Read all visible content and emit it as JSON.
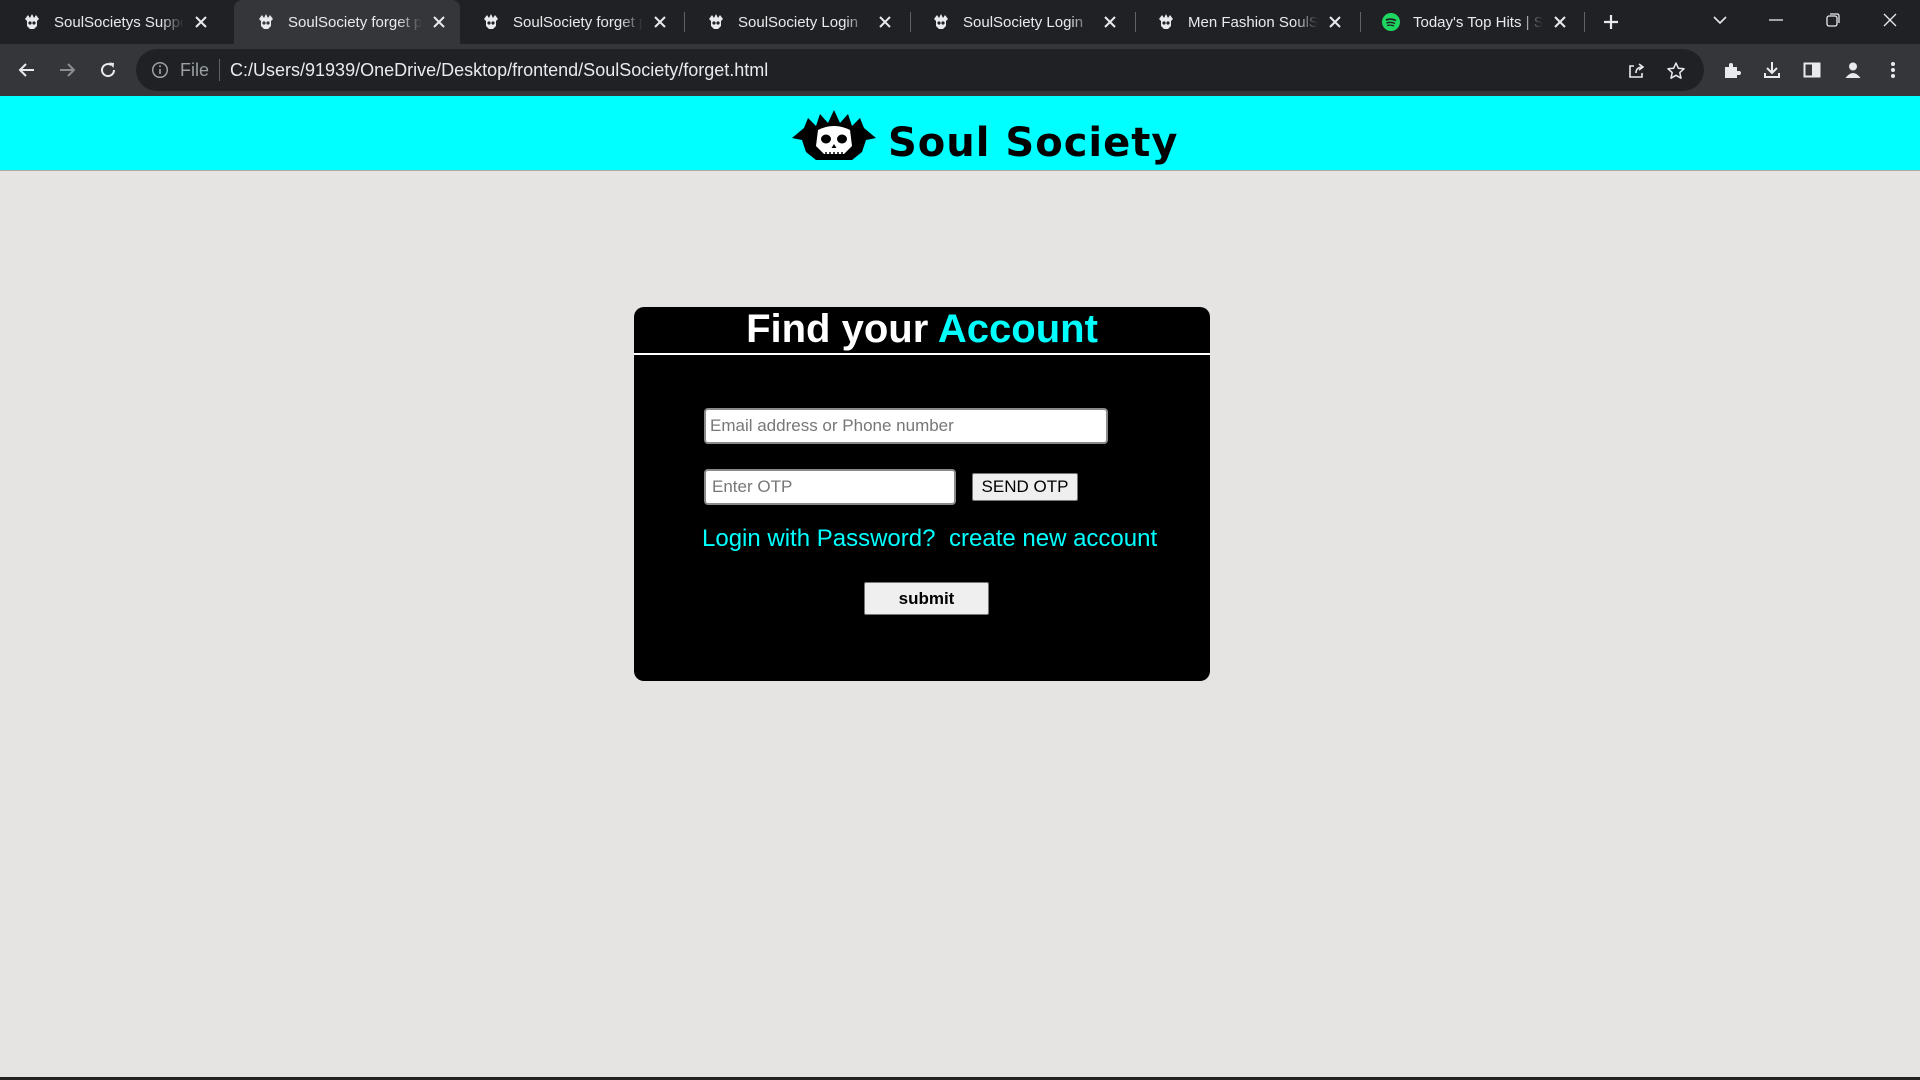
{
  "browser": {
    "tabs": [
      {
        "title": "SoulSocietys Support",
        "icon": "soulsociety-favicon",
        "active": false
      },
      {
        "title": "SoulSociety forget password",
        "icon": "soulsociety-favicon",
        "active": true
      },
      {
        "title": "SoulSociety forget password",
        "icon": "soulsociety-favicon",
        "active": false
      },
      {
        "title": "SoulSociety Login",
        "icon": "soulsociety-favicon",
        "active": false
      },
      {
        "title": "SoulSociety Login",
        "icon": "soulsociety-favicon",
        "active": false
      },
      {
        "title": "Men Fashion SoulSociety",
        "icon": "soulsociety-favicon",
        "active": false
      },
      {
        "title": "Today's Top Hits | Spotify",
        "icon": "spotify-favicon",
        "active": false
      }
    ],
    "address": {
      "scheme_label": "File",
      "url": "C:/Users/91939/OneDrive/Desktop/frontend/SoulSociety/forget.html"
    },
    "colors": {
      "tabbar": "#202124",
      "toolbar": "#35363a",
      "text": "#e8eaed"
    }
  },
  "header": {
    "brand": "Soul Society",
    "logo_icon": "skull-logo-icon",
    "background": "#00ffff"
  },
  "form": {
    "title_part1": "Find your",
    "title_part2": "Account",
    "email_placeholder": "Email address or Phone number",
    "otp_placeholder": "Enter OTP",
    "send_otp_label": "SEND OTP",
    "login_link": "Login with Password?",
    "create_link": "create new account",
    "submit_label": "submit",
    "accent_color": "#00ffff",
    "card_color": "#000000"
  }
}
